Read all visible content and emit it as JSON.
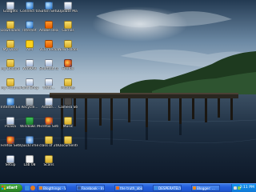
{
  "desktop": {
    "icons": [
      {
        "label": "Gadgets",
        "glyph": "gadget-icon"
      },
      {
        "label": "Connect to...",
        "glyph": "connect-icon"
      },
      {
        "label": "Safari Setup",
        "glyph": "safari-icon"
      },
      {
        "label": "Update Manager",
        "glyph": "update-icon"
      },
      {
        "label": "Downloads",
        "glyph": "folder-icon"
      },
      {
        "label": "Internet",
        "glyph": "web-icon"
      },
      {
        "label": "Adobe Reader",
        "glyph": "reader-icon"
      },
      {
        "label": "Games",
        "glyph": "folder-icon"
      },
      {
        "label": "My Docs",
        "glyph": "folder-icon"
      },
      {
        "label": "AIM",
        "glyph": "aim-icon"
      },
      {
        "label": "VLC media",
        "glyph": "vlc-icon"
      },
      {
        "label": "New Folder",
        "glyph": "folder-icon"
      },
      {
        "label": "My Documents",
        "glyph": "folder-icon"
      },
      {
        "label": "WinRAR",
        "glyph": "app-icon"
      },
      {
        "label": "Shortcut to...",
        "glyph": "app-icon"
      },
      {
        "label": "Firefox",
        "glyph": "firefox-icon"
      },
      {
        "label": "My Pictures",
        "glyph": "folder-icon"
      },
      {
        "label": "Paint Shop Pro",
        "glyph": "app-icon"
      },
      {
        "label": "Vista...",
        "glyph": "app-icon"
      },
      {
        "label": "Pictures",
        "glyph": "folder-icon"
      },
      {
        "label": "Internet Explorer",
        "glyph": "web-icon"
      },
      {
        "label": "Recycle...",
        "glyph": "trash-icon"
      },
      {
        "label": "Adobe...",
        "glyph": "app-icon"
      },
      {
        "label": "Camera Studio",
        "glyph": "camera-icon"
      },
      {
        "label": "Picasa",
        "glyph": "app-icon"
      },
      {
        "label": "Windows Media Player",
        "glyph": "media-icon"
      },
      {
        "label": "Firefox Setup 2.0",
        "glyph": "firefox-icon"
      },
      {
        "label": "Music",
        "glyph": "folder-icon"
      },
      {
        "label": "Firefox Setup 3.0.7",
        "glyph": "firefox-icon"
      },
      {
        "label": "QuickTime Player",
        "glyph": "quicktime-icon"
      },
      {
        "label": "class of 2006 slide",
        "glyph": "folder-icon"
      },
      {
        "label": "Documents",
        "glyph": "folder-icon"
      },
      {
        "label": "Setup",
        "glyph": "app-icon"
      },
      {
        "label": "Lab 08",
        "glyph": "doc-icon"
      },
      {
        "label": "Scans",
        "glyph": "folder-icon"
      }
    ]
  },
  "taskbar": {
    "start_label": "start",
    "buttons": [
      {
        "label": "Blogthings - What Ge..."
      },
      {
        "label": "Facebook - Index"
      },
      {
        "label": "the truth_about blogthi..."
      },
      {
        "label": "DESPERATELY SEEK..."
      },
      {
        "label": "Blogger: ..."
      }
    ],
    "clock": "2:11 PM"
  },
  "colors": {
    "taskbar_blue": "#245edb",
    "start_green": "#2f8f2a",
    "tray_blue": "#0f79d6"
  }
}
